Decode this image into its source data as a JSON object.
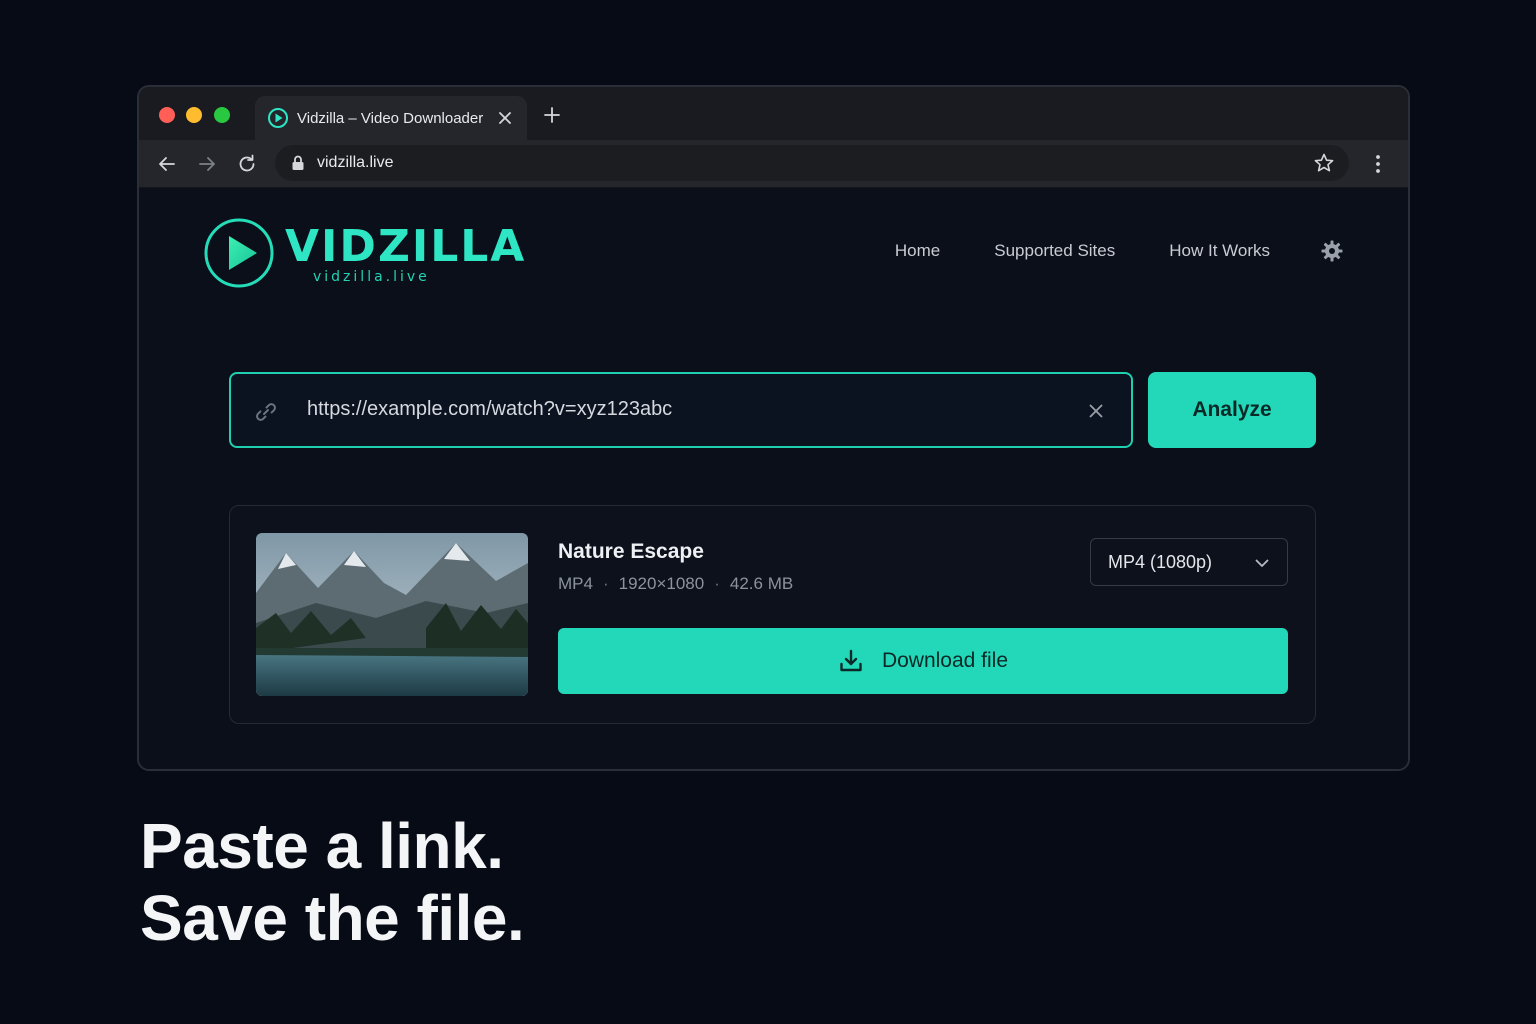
{
  "browser": {
    "tab_title": "Vidzilla – Video Downloader",
    "url": "vidzilla.live"
  },
  "site": {
    "logo_word": "VIDZILLA",
    "logo_sub": "vidzilla.live",
    "nav": [
      {
        "label": "Home"
      },
      {
        "label": "Supported Sites"
      },
      {
        "label": "How It Works"
      }
    ]
  },
  "search": {
    "value": "https://example.com/watch?v=xyz123abc",
    "analyze_label": "Analyze"
  },
  "result": {
    "title": "Nature Escape",
    "format": "MP4",
    "resolution": "1920×1080",
    "size": "42.6 MB",
    "selected_format": "MP4 (1080p)",
    "download_label": "Download file"
  },
  "tagline": {
    "line1": "Paste a link.",
    "line2": "Save the file."
  },
  "colors": {
    "accent": "#22d8b8",
    "background": "#070b16"
  }
}
